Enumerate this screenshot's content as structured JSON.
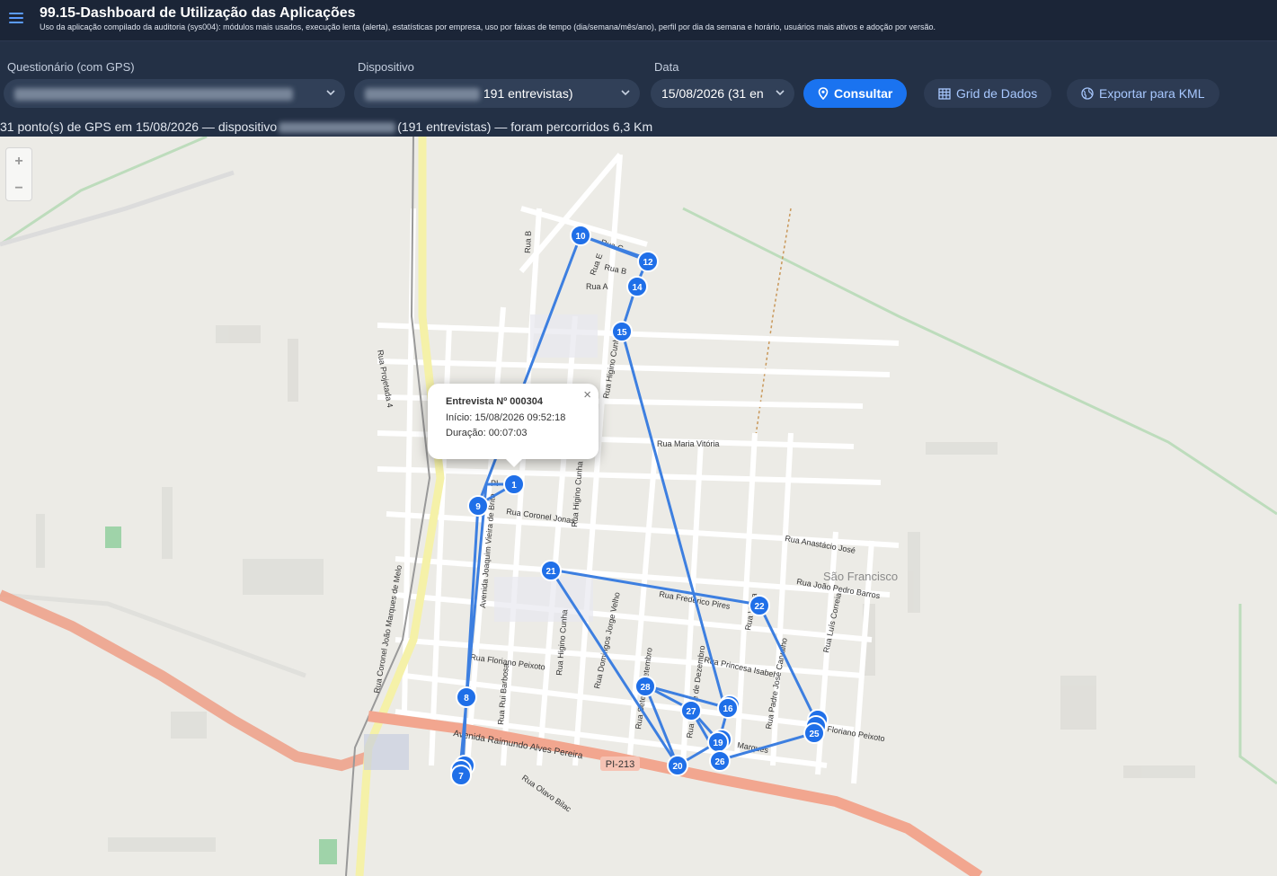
{
  "header": {
    "menu_icon": "hamburger-menu-icon",
    "title": "99.15-Dashboard de Utilização das Aplicações",
    "subtitle": "Uso da aplicação compilado da auditoria (sys004): módulos mais usados, execução lenta (alerta), estatísticas por empresa, uso por faixas de tempo (dia/semana/mês/ano), perfil por dia da semana e horário, usuários mais ativos e adoção por versão."
  },
  "filters": {
    "questionario_label": "Questionário (com GPS)",
    "dispositivo_label": "Dispositivo",
    "dispositivo_value_suffix": "191 entrevistas)",
    "data_label": "Data",
    "data_value": "15/08/2026 (31 en"
  },
  "actions": {
    "consultar_label": "Consultar",
    "grid_label": "Grid de Dados",
    "kml_label": "Exportar para KML"
  },
  "status": {
    "part1": "31 ponto(s) de GPS em 15/08/2026 — dispositivo",
    "part2": "(191 entrevistas) — foram percorridos 6,3 Km"
  },
  "map": {
    "zoom_in": "+",
    "zoom_out": "−",
    "route_color": "#3d7fe0",
    "marker_color": "#1f6fe8",
    "streets": [
      "Rua B",
      "Rua C",
      "Rua E",
      "Rua B",
      "Rua A",
      "Rua Projetada 4",
      "Rua Higino Cunha",
      "Rua Maria Vitória",
      "Rua Coronel Jonas",
      "Rua Higino Cunha",
      "Avenida Joaquim Vieira de Brito",
      "Rua Anastácio José",
      "Rua João Pedro Barros",
      "Rua Frederico Pires",
      "Rua Coronel João Marques de Melo",
      "Rua Floriano Peixoto",
      "Rua Higino Cunha",
      "Rua Domingos Jorge Velho",
      "Rua Princesa Isabel",
      "Rua Padre José Carvalho",
      "Rua Luís Correia",
      "Rua Rui Barbosa",
      "Avenida Raimundo Alves Pereira",
      "Rua Olavo Bilac",
      "Rua Sete de Setembro",
      "Rua Quinze de Dezembro",
      "Rua Vieira",
      "Marques",
      "Floriano Peixoto",
      "São Francisco",
      "PI-213",
      "PI-"
    ],
    "points": [
      "1",
      "7",
      "8",
      "9",
      "10",
      "12",
      "14",
      "15",
      "16",
      "19",
      "20",
      "21",
      "22",
      "25",
      "26",
      "27",
      "28"
    ]
  },
  "popup": {
    "title": "Entrevista Nº 000304",
    "inicio": "Início: 15/08/2026 09:52:18",
    "duracao": "Duração: 00:07:03",
    "close": "×"
  }
}
